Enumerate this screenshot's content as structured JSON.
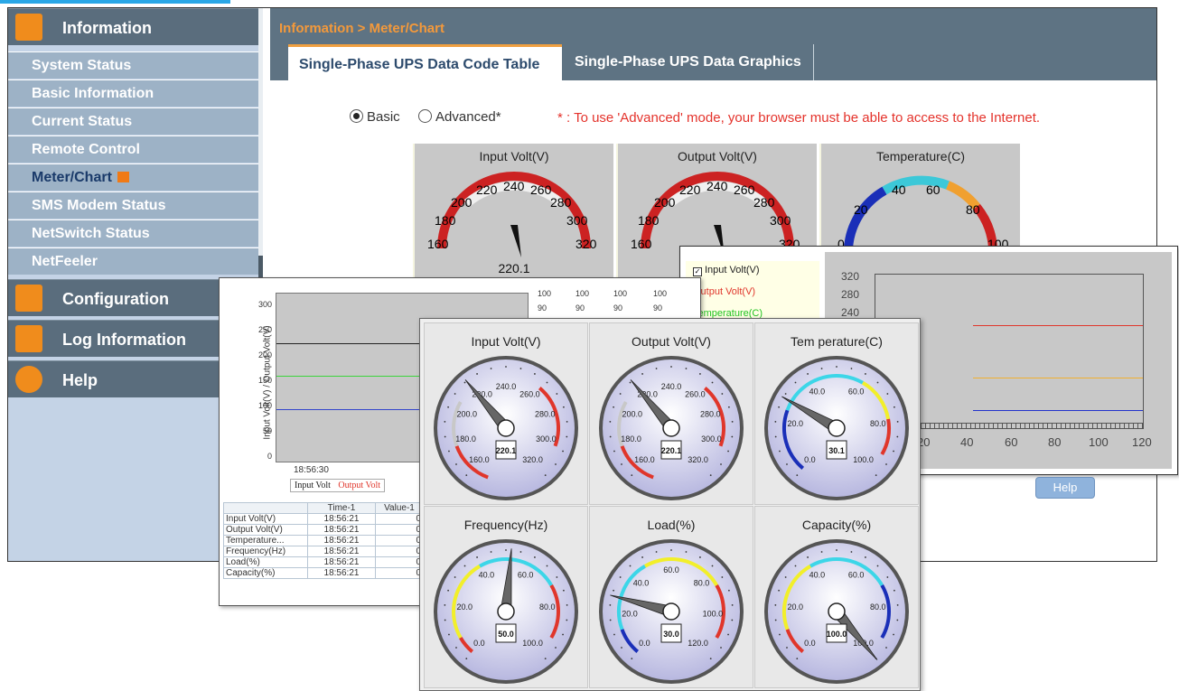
{
  "sidebar": {
    "sections": [
      {
        "label": "Information",
        "icon": "monitor-icon"
      },
      {
        "label": "Configuration",
        "icon": "tools-icon"
      },
      {
        "label": "Log Information",
        "icon": "folder-icon"
      },
      {
        "label": "Help",
        "icon": "info-icon"
      }
    ],
    "items": [
      {
        "label": "System Status"
      },
      {
        "label": "Basic Information"
      },
      {
        "label": "Current Status"
      },
      {
        "label": "Remote Control"
      },
      {
        "label": "Meter/Chart"
      },
      {
        "label": "SMS Modem Status"
      },
      {
        "label": "NetSwitch Status"
      },
      {
        "label": "NetFeeler"
      }
    ]
  },
  "header": {
    "breadcrumb": "Information > Meter/Chart",
    "tabs": [
      {
        "label": "Single-Phase UPS Data Code Table"
      },
      {
        "label": "Single-Phase UPS Data Graphics"
      }
    ]
  },
  "mode": {
    "basic_label": "Basic",
    "advanced_label": "Advanced*",
    "note": "* : To use 'Advanced' mode, your browser must be able to access to the Internet."
  },
  "meters": [
    {
      "title": "Input Volt(V)",
      "ticks": [
        "160",
        "180",
        "200",
        "220",
        "240",
        "260",
        "280",
        "300",
        "320"
      ],
      "reading": "220.1"
    },
    {
      "title": "Output Volt(V)",
      "ticks": [
        "160",
        "180",
        "200",
        "220",
        "240",
        "260",
        "280",
        "300",
        "320"
      ]
    },
    {
      "title": "Temperature(C)",
      "ticks": [
        "0",
        "20",
        "40",
        "60",
        "80",
        "100"
      ]
    }
  ],
  "line_chart": {
    "ylabel": "Input Volt(V) / Output Volt(V)",
    "yticks": [
      "0",
      "50",
      "100",
      "150",
      "200",
      "250",
      "300"
    ],
    "xtick": "18:56:30",
    "legend": [
      "Input Volt",
      "Output Volt"
    ],
    "mini_scale": [
      "100",
      "90"
    ],
    "table_headers": [
      "",
      "Time-1",
      "Value-1"
    ],
    "table_rows": [
      {
        "name": "Input Volt(V)",
        "time": "18:56:21",
        "value": "0"
      },
      {
        "name": "Output Volt(V)",
        "time": "18:56:21",
        "value": "0"
      },
      {
        "name": "Temperature...",
        "time": "18:56:21",
        "value": "0"
      },
      {
        "name": "Frequency(Hz)",
        "time": "18:56:21",
        "value": "0"
      },
      {
        "name": "Load(%)",
        "time": "18:56:21",
        "value": "0"
      },
      {
        "name": "Capacity(%)",
        "time": "18:56:21",
        "value": "0"
      }
    ]
  },
  "graph": {
    "legend": [
      {
        "label": "Input Volt(V)",
        "color": "#222222",
        "checked": true
      },
      {
        "label": "Output Volt(V)",
        "color": "#e0362b"
      },
      {
        "label": "Temperature(C)",
        "color": "#22c422"
      }
    ],
    "yticks": [
      "320",
      "280",
      "240"
    ],
    "xticks": [
      "20",
      "40",
      "60",
      "80",
      "100",
      "120"
    ],
    "help_label": "Help"
  },
  "gauges": [
    {
      "title": "Input Volt(V)",
      "value": "220.1",
      "labels": [
        "160.0",
        "180.0",
        "200.0",
        "220.0",
        "240.0",
        "260.0",
        "280.0",
        "300.0",
        "320.0"
      ]
    },
    {
      "title": "Output Volt(V)",
      "value": "220.1",
      "labels": [
        "160.0",
        "180.0",
        "200.0",
        "220.0",
        "240.0",
        "260.0",
        "280.0",
        "300.0",
        "320.0"
      ]
    },
    {
      "title": "Tem perature(C)",
      "value": "30.1",
      "labels": [
        "0.0",
        "20.0",
        "40.0",
        "60.0",
        "80.0",
        "100.0"
      ]
    },
    {
      "title": "Frequency(Hz)",
      "value": "50.0",
      "labels": [
        "0.0",
        "20.0",
        "40.0",
        "60.0",
        "80.0",
        "100.0"
      ]
    },
    {
      "title": "Load(%)",
      "value": "30.0",
      "labels": [
        "0.0",
        "20.0",
        "40.0",
        "60.0",
        "80.0",
        "100.0",
        "120.0"
      ]
    },
    {
      "title": "Capacity(%)",
      "value": "100.0",
      "labels": [
        "0.0",
        "20.0",
        "40.0",
        "60.0",
        "80.0",
        "100.0"
      ]
    }
  ],
  "colors": {
    "accent": "#f08c1c",
    "header": "#5e7383",
    "sidebar": "#9db2c6",
    "alert": "#e4322b"
  }
}
